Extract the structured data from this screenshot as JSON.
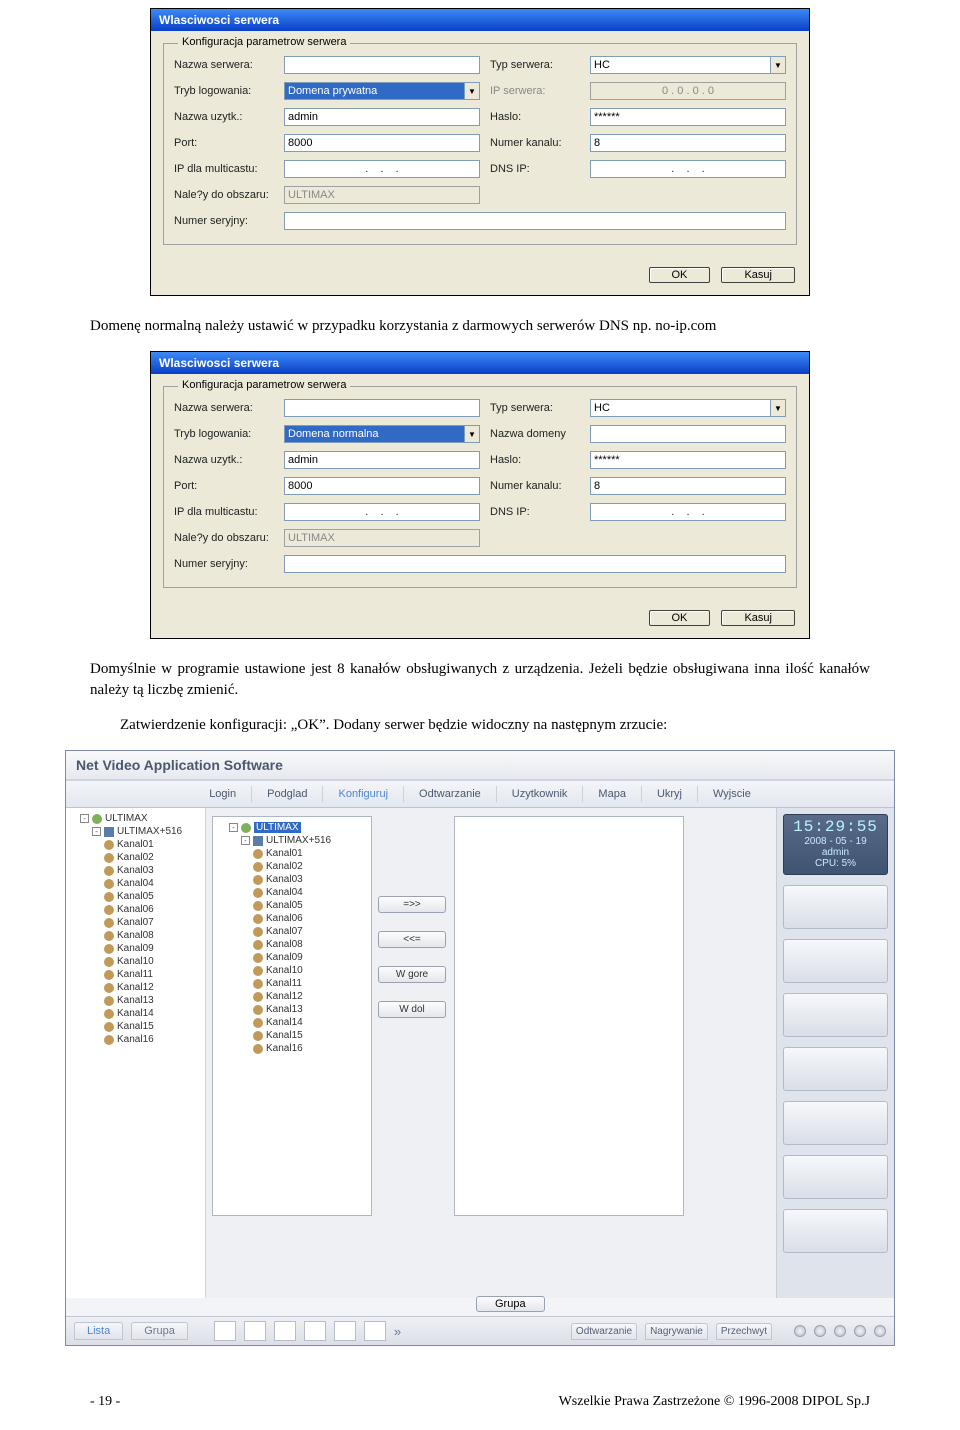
{
  "dialog1": {
    "title": "Wlasciwosci serwera",
    "legend": "Konfiguracja parametrow serwera",
    "labels": {
      "nazwa_serwera": "Nazwa serwera:",
      "typ_serwera": "Typ serwera:",
      "tryb_logowania": "Tryb logowania:",
      "ip_serwera": "IP serwera:",
      "nazwa_uzytk": "Nazwa uzytk.:",
      "haslo": "Haslo:",
      "port": "Port:",
      "numer_kanalu": "Numer kanalu:",
      "ip_multicastu": "IP dla multicastu:",
      "dns_ip": "DNS IP:",
      "nalezy_obszaru": "Nale?y do obszaru:",
      "numer_seryjny": "Numer seryjny:"
    },
    "values": {
      "nazwa_serwera": "",
      "typ_serwera": "HC",
      "tryb_logowania": "Domena prywatna",
      "ip_serwera": "0 . 0 . 0 . 0",
      "nazwa_uzytk": "admin",
      "haslo": "******",
      "port": "8000",
      "numer_kanalu": "8",
      "nalezy_obszaru": "ULTIMAX",
      "numer_seryjny": ""
    },
    "ok": "OK",
    "kasuj": "Kasuj"
  },
  "para1": "Domenę normalną należy ustawić w przypadku korzystania z darmowych serwerów DNS np. no-ip.com",
  "dialog2": {
    "title": "Wlasciwosci serwera",
    "legend": "Konfiguracja parametrow serwera",
    "labels": {
      "nazwa_serwera": "Nazwa serwera:",
      "typ_serwera": "Typ serwera:",
      "tryb_logowania": "Tryb logowania:",
      "nazwa_domeny": "Nazwa domeny",
      "nazwa_uzytk": "Nazwa uzytk.:",
      "haslo": "Haslo:",
      "port": "Port:",
      "numer_kanalu": "Numer kanalu:",
      "ip_multicastu": "IP dla multicastu:",
      "dns_ip": "DNS IP:",
      "nalezy_obszaru": "Nale?y do obszaru:",
      "numer_seryjny": "Numer seryjny:"
    },
    "values": {
      "nazwa_serwera": "",
      "typ_serwera": "HC",
      "tryb_logowania": "Domena normalna",
      "nazwa_domeny": "",
      "nazwa_uzytk": "admin",
      "haslo": "******",
      "port": "8000",
      "numer_kanalu": "8",
      "nalezy_obszaru": "ULTIMAX",
      "numer_seryjny": ""
    },
    "ok": "OK",
    "kasuj": "Kasuj"
  },
  "para2a": "Domyślnie w programie ustawione jest 8 kanałów obsługiwanych z urządzenia. Jeżeli będzie obsługiwana inna ilość kanałów należy tą liczbę zmienić.",
  "para2b": "Zatwierdzenie konfiguracji: „OK”. Dodany serwer będzie widoczny na następnym zrzucie:",
  "app": {
    "title": "Net Video Application Software",
    "nav": [
      "Login",
      "Podglad",
      "Konfiguruj",
      "Odtwarzanie",
      "Uzytkownik",
      "Mapa",
      "Ukryj",
      "Wyjscie"
    ],
    "nav_active": 2,
    "tree_root": "ULTIMAX",
    "tree_device": "ULTIMAX+516",
    "tree_channels": [
      "Kanal01",
      "Kanal02",
      "Kanal03",
      "Kanal04",
      "Kanal05",
      "Kanal06",
      "Kanal07",
      "Kanal08",
      "Kanal09",
      "Kanal10",
      "Kanal11",
      "Kanal12",
      "Kanal13",
      "Kanal14",
      "Kanal15",
      "Kanal16"
    ],
    "transfer": {
      "add": "=>>",
      "remove": "<<=",
      "up": "W gore",
      "down": "W dol"
    },
    "clock": {
      "time": "15:29:55",
      "date": "2008 - 05 - 19",
      "user": "admin",
      "cpu": "CPU: 5%"
    },
    "tabs": {
      "lista": "Lista",
      "grupa": "Grupa"
    },
    "grupa_btn": "Grupa",
    "rec_tabs": [
      "Odtwarzanie",
      "Nagrywanie",
      "Przechwyt"
    ],
    "chevron": "»"
  },
  "footer": {
    "left": "- 19 -",
    "right": "Wszelkie Prawa Zastrzeżone © 1996-2008 DIPOL Sp.J"
  }
}
